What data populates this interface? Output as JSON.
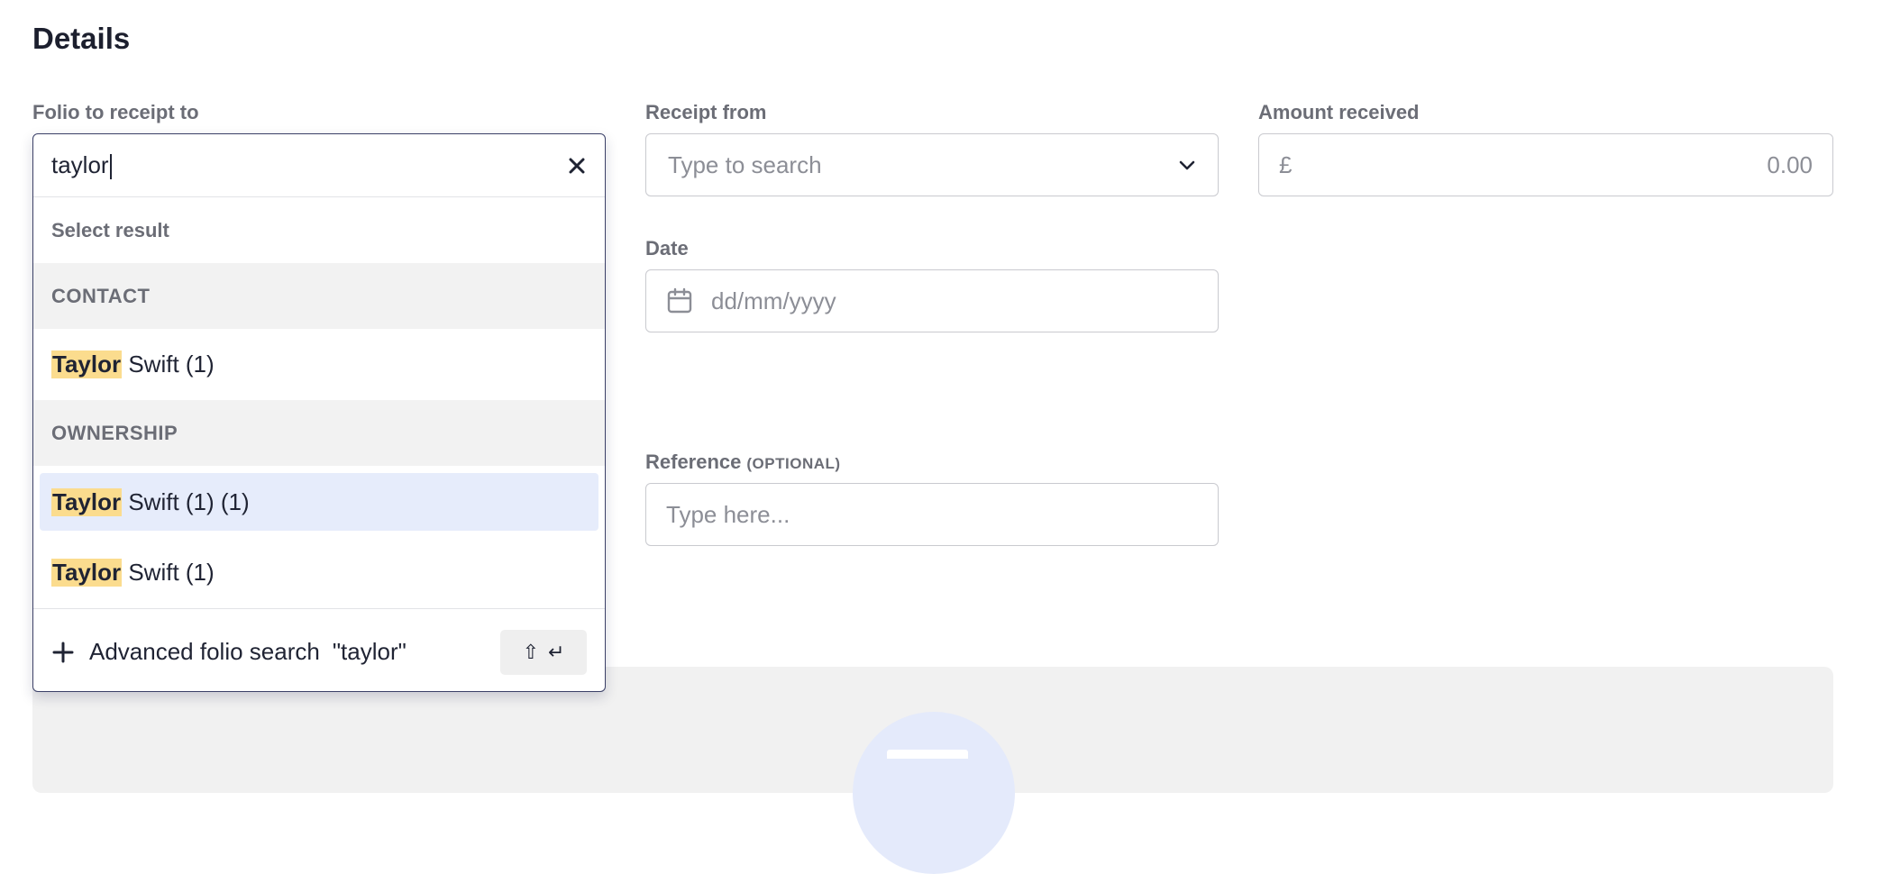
{
  "section": {
    "title": "Details"
  },
  "folio": {
    "label": "Folio to receipt to",
    "query": "taylor",
    "hint": "Select result",
    "groups": [
      {
        "name": "CONTACT"
      },
      {
        "name": "OWNERSHIP"
      }
    ],
    "results": [
      {
        "match": "Taylor",
        "rest": " Swift (1)"
      },
      {
        "match": "Taylor",
        "rest": " Swift (1) (1)"
      },
      {
        "match": "Taylor",
        "rest": " Swift (1)"
      }
    ],
    "advanced_label": "Advanced folio search",
    "advanced_query": "\"taylor\"",
    "shortcut": {
      "shift": "⇧",
      "enter": "↵"
    },
    "clear_icon": "close-icon",
    "add_icon": "plus-icon"
  },
  "receipt_from": {
    "label": "Receipt from",
    "placeholder": "Type to search",
    "icon": "chevron-down-icon"
  },
  "amount": {
    "label": "Amount received",
    "currency": "£",
    "value": "0.00"
  },
  "date": {
    "label": "Date",
    "placeholder": "dd/mm/yyyy",
    "icon": "calendar-icon"
  },
  "reference": {
    "label": "Reference",
    "optional": "(OPTIONAL)",
    "placeholder": "Type here..."
  },
  "colors": {
    "highlight": "#fbdc8e",
    "active_row": "#e6ecfb",
    "accent_border": "#3b4067"
  }
}
